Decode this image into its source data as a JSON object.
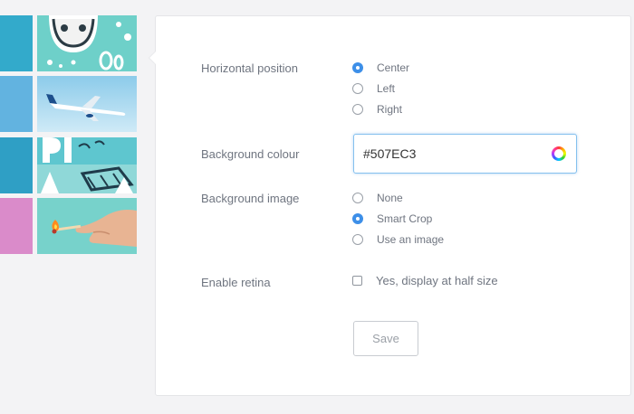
{
  "settings": {
    "horizontal_position": {
      "label": "Horizontal position",
      "options": [
        {
          "label": "Center",
          "selected": true
        },
        {
          "label": "Left",
          "selected": false
        },
        {
          "label": "Right",
          "selected": false
        }
      ]
    },
    "background_colour": {
      "label": "Background colour",
      "value": "#507EC3"
    },
    "background_image": {
      "label": "Background image",
      "options": [
        {
          "label": "None",
          "selected": false
        },
        {
          "label": "Smart Crop",
          "selected": true
        },
        {
          "label": "Use an image",
          "selected": false
        }
      ]
    },
    "retina": {
      "label": "Enable retina",
      "checkbox_label": "Yes, display at half size",
      "checked": false
    },
    "save_label": "Save"
  },
  "colors": {
    "accent": "#3d8fe8",
    "strip_teal": "#2fa8c8",
    "strip_blue": "#5aaee0",
    "strip_pink": "#d98ac8",
    "art_teal": "#66cfc9"
  },
  "thumbnails": [
    {
      "name": "doodle-face"
    },
    {
      "name": "airplane"
    },
    {
      "name": "play-sign"
    },
    {
      "name": "hand-match"
    }
  ]
}
